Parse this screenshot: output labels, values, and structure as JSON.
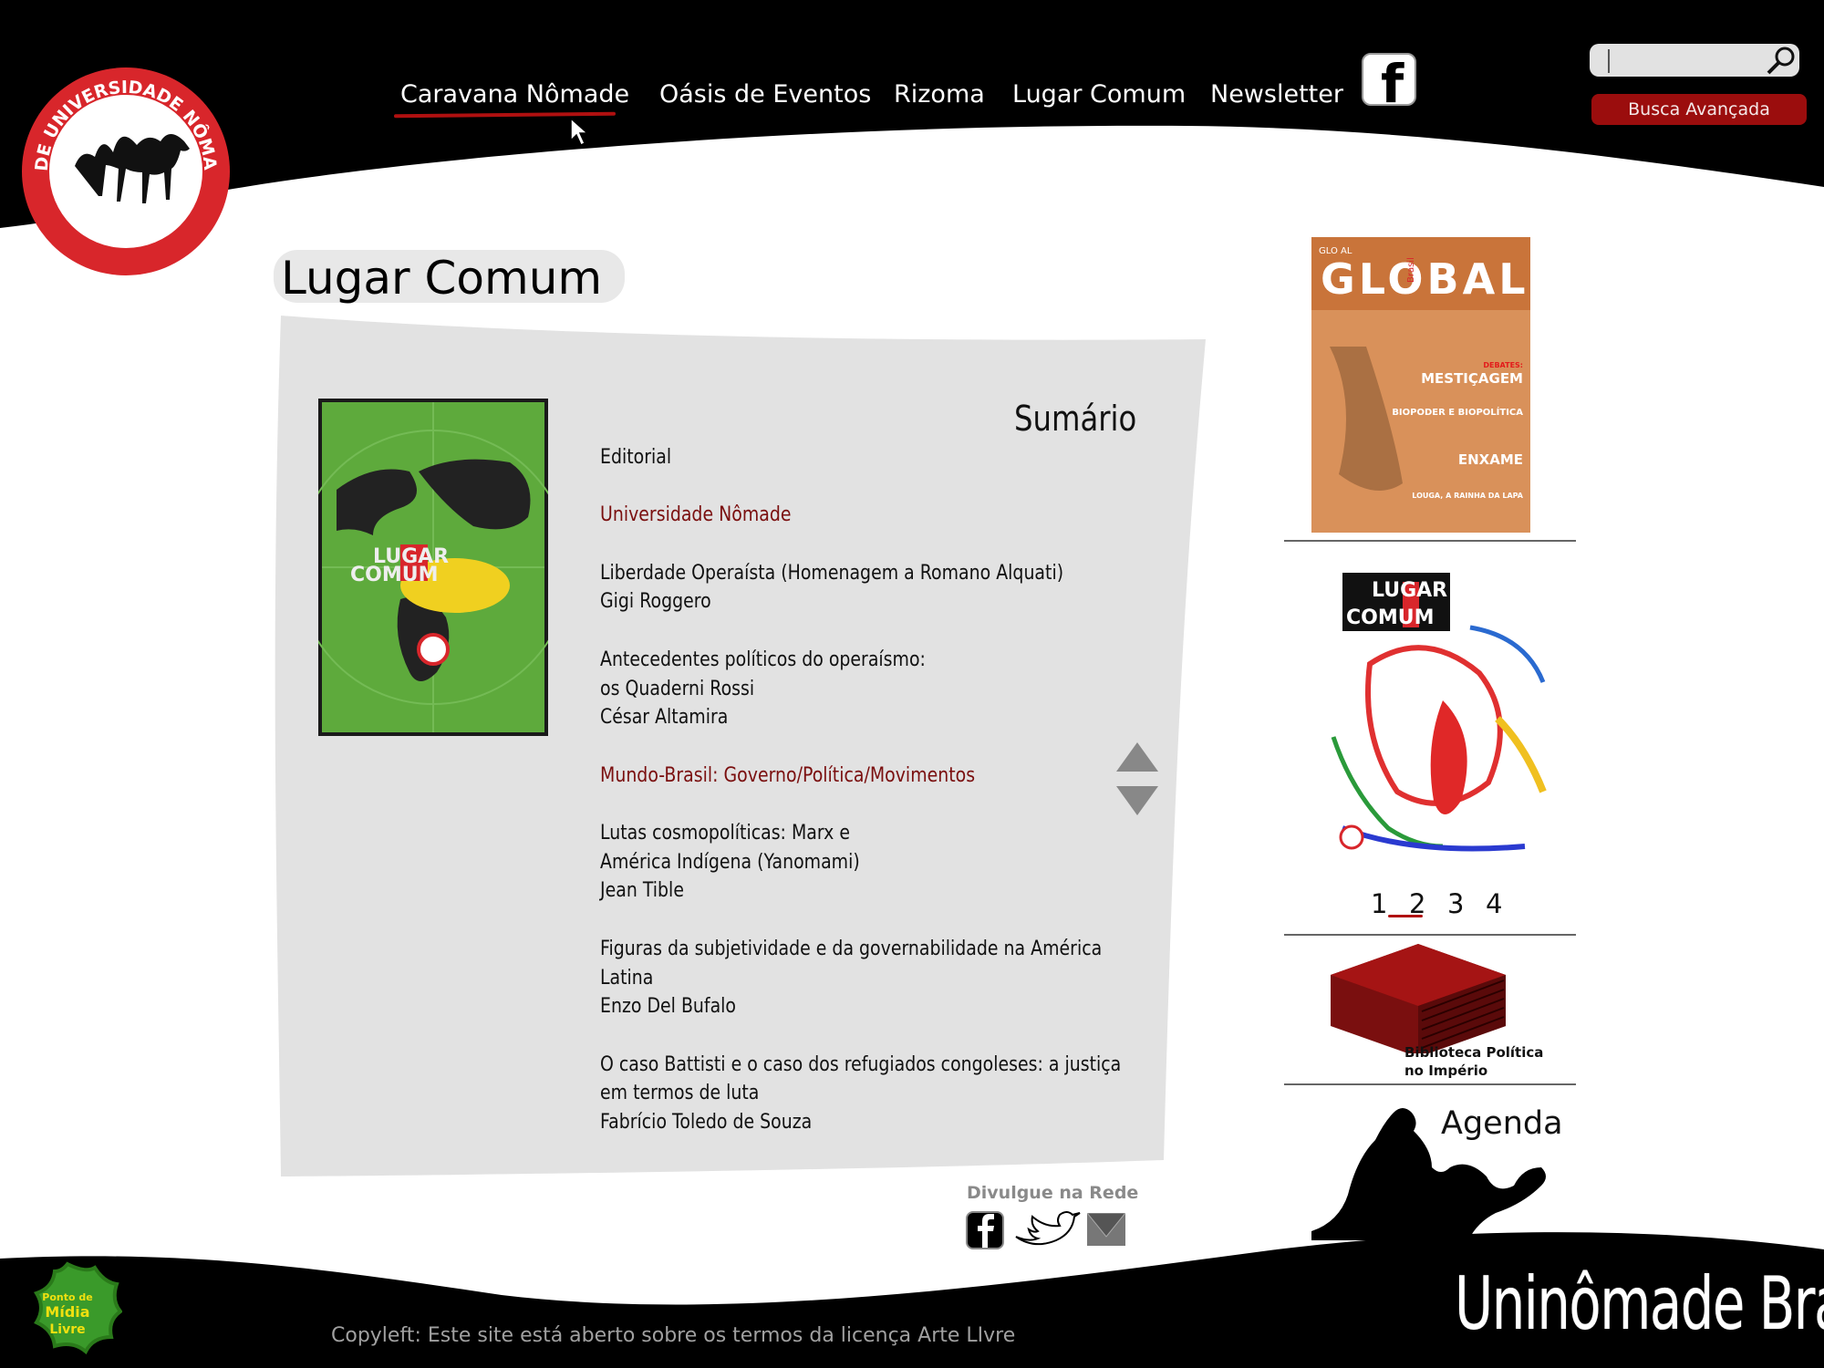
{
  "header": {
    "nav": [
      {
        "label": "Caravana Nômade"
      },
      {
        "label": "Oásis de Eventos"
      },
      {
        "label": "Rizoma"
      },
      {
        "label": "Lugar Comum"
      },
      {
        "label": "Newsletter"
      }
    ],
    "active_nav": "Caravana Nômade",
    "search": {
      "value": "",
      "placeholder": ""
    },
    "advanced_search_label": "Busca Avançada",
    "logo_text": "REDE UNIVERSIDADE NÔMADE"
  },
  "main": {
    "title": "Lugar Comum",
    "cover_title_top": "LUGAR",
    "cover_title_bottom": "COMUM",
    "summary_heading": "Sumário",
    "toc": [
      {
        "lines": [
          "Editorial"
        ],
        "highlight": false
      },
      {
        "lines": [
          "Universidade Nômade"
        ],
        "highlight": true
      },
      {
        "lines": [
          "Liberdade Operaísta (Homenagem a Romano Alquati)",
          "Gigi Roggero"
        ],
        "highlight": false
      },
      {
        "lines": [
          "Antecedentes políticos do operaísmo:",
          "os Quaderni Rossi",
          "César Altamira"
        ],
        "highlight": false
      },
      {
        "lines": [
          "Mundo-Brasil: Governo/Política/Movimentos"
        ],
        "highlight": true
      },
      {
        "lines": [
          "Lutas cosmopolíticas: Marx e",
          "América Indígena (Yanomami)",
          "Jean Tible"
        ],
        "highlight": false
      },
      {
        "lines": [
          "Figuras da subjetividade e da governabilidade na América",
          "Latina",
          "Enzo Del Bufalo"
        ],
        "highlight": false
      },
      {
        "lines": [
          "O caso Battisti e o caso dos refugiados congoleses: a justiça",
          "em termos de luta",
          "Fabrício Toledo de Souza"
        ],
        "highlight": false
      }
    ],
    "share_label": "Divulgue na Rede"
  },
  "sidebar": {
    "global_cover": {
      "title": "GLOBAL",
      "subtitle": "Brasil",
      "headlines": [
        "DEBATES:",
        "MESTIÇAGEM",
        "BIOPODER E BIOPOLÍTICA",
        "ENXAME",
        "LOUGA, A RAINHA DA LAPA"
      ]
    },
    "lugar_cover": {
      "title_top": "LUGAR",
      "title_bottom": "COMUM"
    },
    "pages": [
      "1",
      "2",
      "3",
      "4"
    ],
    "active_page": "2",
    "biblioteca_label_line1": "Biblioteca Política",
    "biblioteca_label_line2": "no Império",
    "agenda_label": "Agenda"
  },
  "footer": {
    "ponto_logo_text": "Ponto de Mídia Livre",
    "copyleft": "Copyleft: Este site está aberto sobre os termos da licença Arte LIvre",
    "brand": "Uninômade Brasil"
  },
  "colors": {
    "header_bg": "#000000",
    "accent_red": "#9b0d0d",
    "highlight_link": "#7a0f0f",
    "panel_bg": "#e2e2e2"
  }
}
